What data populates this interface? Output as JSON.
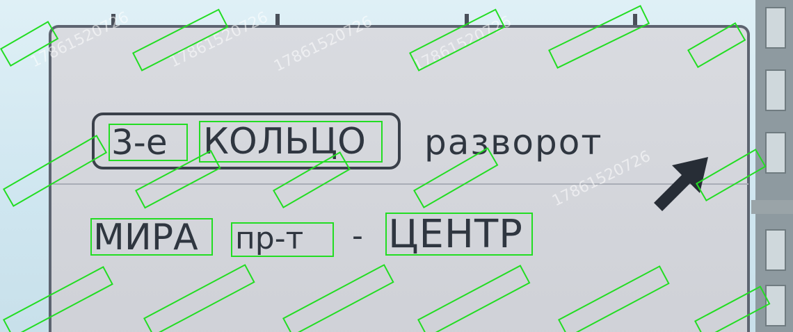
{
  "sign": {
    "ring_number": "3-е",
    "ring_word": "КОЛЬЦО",
    "turn_label": "разворот",
    "street_name": "МИРА",
    "street_type": "пр-т",
    "separator": "-",
    "destination": "ЦЕНТР"
  },
  "watermark": {
    "text": "17861520726"
  },
  "colors": {
    "sign_face": "#d3d5db",
    "sign_text": "#2f3640",
    "detection_box": "#22dd22",
    "sky": "#d6ecf3"
  },
  "icons": {
    "direction_arrow": "arrow-up-right-icon"
  }
}
